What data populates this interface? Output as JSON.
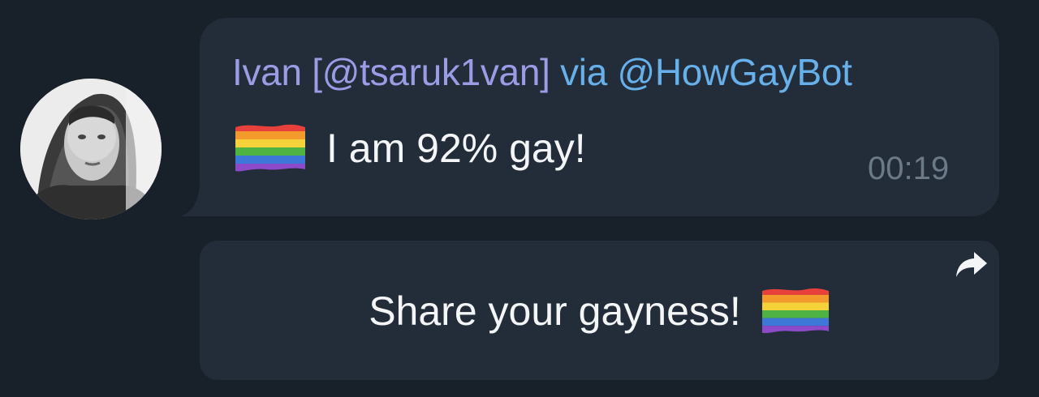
{
  "message": {
    "sender_name": "Ivan [@tsaruk1van]",
    "via_label": "via",
    "bot_username": "@HowGayBot",
    "text": "I am 92% gay!",
    "time": "00:19",
    "flag_icon": "rainbow-flag-icon"
  },
  "inline_keyboard": {
    "button_label": "Share your gayness!",
    "flag_icon": "rainbow-flag-icon",
    "corner_icon": "forward-arrow-icon"
  },
  "colors": {
    "background": "#18202a",
    "bubble": "#222d39",
    "sender_name": "#9b9ce6",
    "bot_link": "#67b0ea",
    "message_text": "#f3f5f7",
    "timestamp": "#6c7a88"
  }
}
